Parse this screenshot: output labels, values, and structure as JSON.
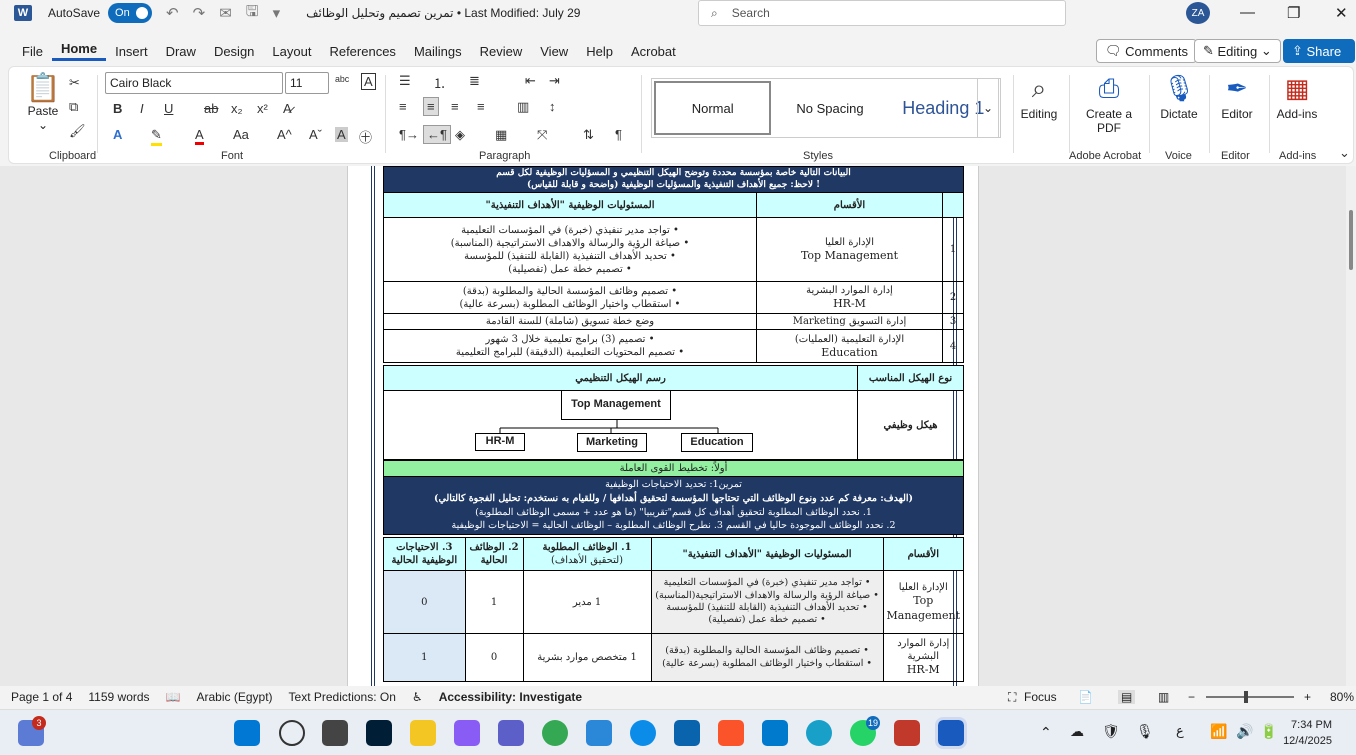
{
  "titlebar": {
    "autosave": "AutoSave",
    "toggle": "On",
    "doc_title": "تمرين تصميم وتحليل الوظائف  •  Last Modified: July 29",
    "search_placeholder": "Search",
    "avatar": "ZA"
  },
  "menu": [
    "File",
    "Home",
    "Insert",
    "Draw",
    "Design",
    "Layout",
    "References",
    "Mailings",
    "Review",
    "View",
    "Help",
    "Acrobat"
  ],
  "ribbon_buttons": {
    "comments": "Comments",
    "editing": "Editing",
    "share": "Share"
  },
  "ribbon": {
    "paste": "Paste",
    "clipboard": "Clipboard",
    "font_name": "Cairo Black",
    "font_size": "11",
    "font": "Font",
    "paragraph": "Paragraph",
    "styles": [
      "Normal",
      "No Spacing",
      "Heading 1"
    ],
    "styles_label": "Styles",
    "editing": "Editing",
    "create_pdf": "Create a PDF",
    "adobe": "Adobe Acrobat",
    "dictate": "Dictate",
    "voice": "Voice",
    "editor": "Editor",
    "editor_grp": "Editor",
    "addins": "Add-ins",
    "addins_grp": "Add-ins"
  },
  "doc": {
    "header1": "البيانات التالية خاصة بمؤسسة محددة وتوضح الهيكل التنظيمي و المسؤليات الوظيفية لكل قسم",
    "header2": "! لاحظ: جميع الأهداف التنفيذية والمسؤليات الوظيفية (واضحة و قابلة للقياس)",
    "col_dept": "الأقسام",
    "col_resp": "المسئوليات الوظيفية  \"الأهداف التنفيذية\"",
    "rows": [
      {
        "n": "1",
        "dept": "الإدارة العليا",
        "dept_en": "Top Management",
        "items": [
          "• تواجد مدير تنفيذي (خبرة) في المؤسسات التعليمية",
          "• صياغة الرؤية والرسالة والاهداف الاستراتيجية (المناسبة)",
          "• تحديد الأهداف التنفيذية (القابلة للتنفيذ) للمؤسسة",
          "• تصميم خطة عمل (تفصيلية)"
        ]
      },
      {
        "n": "2",
        "dept": "إدارة الموارد البشرية",
        "dept_en": "HR-M",
        "items": [
          "• تصميم وظائف المؤسسة الحالية والمطلوبة (بدقة)",
          "• استقطاب واختيار الوظائف المطلوبة (بسرعة عالية)"
        ]
      },
      {
        "n": "3",
        "dept": "إدارة التسويق Marketing",
        "dept_en": "",
        "items": [
          "وضع خطة تسويق (شاملة) للسنة القادمة"
        ]
      },
      {
        "n": "4",
        "dept": "الإدارة التعليمية (العمليات)",
        "dept_en": "Education",
        "items": [
          "• تصميم (3) برامج تعليمية خلال 3 شهور",
          "• تصميم المحتويات التعليمية (الدقيقة) للبرامج التعليمية"
        ]
      }
    ],
    "struct_type_label": "نوع الهيكل المناسب",
    "struct_draw_label": "رسم الهيكل التنظيمي",
    "struct_type": "هيكل وظيفي",
    "org": {
      "top": "Top Management",
      "c1": "HR-M",
      "c2": "Marketing",
      "c3": "Education"
    },
    "section": "أولاً: تخطيط القوى العاملة",
    "ex1": "تمرين1: تحديد الاحتياجات الوظيفية",
    "goal": "(الهدف: معرفة كم عدد ونوع الوظائف التي تحتاجها المؤسسة لتحقيق أهدافها / وللقيام به نستخدم: تحليل الفجوة كالتالي)",
    "step1": "1. نحدد الوظائف المطلوبة لتحقيق أهداف كل قسم\"تقريبيا\" (ما هو عدد + مسمى الوظائف المطلوبة)",
    "step2": "2. نحدد الوظائف الموجودة حاليا في القسم  3. نطرح الوظائف المطلوبة – الوظائف الحالية = الاحتياجات الوظيفية",
    "t2_dept": "الأقسام",
    "t2_resp": "المسئوليات الوظيفية \"الأهداف التنفيذية\"",
    "t2_req": "1.  الوظائف المطلوبة",
    "t2_req_sub": "(لتحقيق الأهداف)",
    "t2_cur": "2. الوظائف الحالية",
    "t2_need": "3. الاحتياجات الوظيفية الحالية",
    "t2_rows": [
      {
        "dept": "الإدارة العليا",
        "dept_en": "Top Management",
        "items": [
          "• تواجد مدير تنفيذي (خبرة) في المؤسسات التعليمية",
          "• صياغة الرؤية والرسالة والاهداف الاستراتيجية(المناسبة)",
          "• تحديد الأهداف التنفيذية (القابلة للتنفيذ) للمؤسسة",
          "• تصميم خطة عمل (تفصيلية)"
        ],
        "req": "1 مدير",
        "cur": "1",
        "need": "0"
      },
      {
        "dept": "إدارة الموارد البشرية",
        "dept_en": "HR-M",
        "items": [
          "• تصميم وظائف المؤسسة الحالية والمطلوبة (بدقة)",
          "• استقطاب واختيار الوظائف المطلوبة (بسرعة عالية)"
        ],
        "req": "1 متخصص موارد بشرية",
        "cur": "0",
        "need": "1"
      }
    ]
  },
  "status": {
    "page": "Page 1 of 4",
    "words": "1159 words",
    "lang": "Arabic (Egypt)",
    "pred": "Text Predictions: On",
    "access": "Accessibility: Investigate",
    "focus": "Focus",
    "zoom": "80%"
  },
  "taskbar": {
    "time": "7:34 PM",
    "date": "12/4/2025",
    "badge1": "3",
    "badge2": "19",
    "lang": "ع"
  }
}
